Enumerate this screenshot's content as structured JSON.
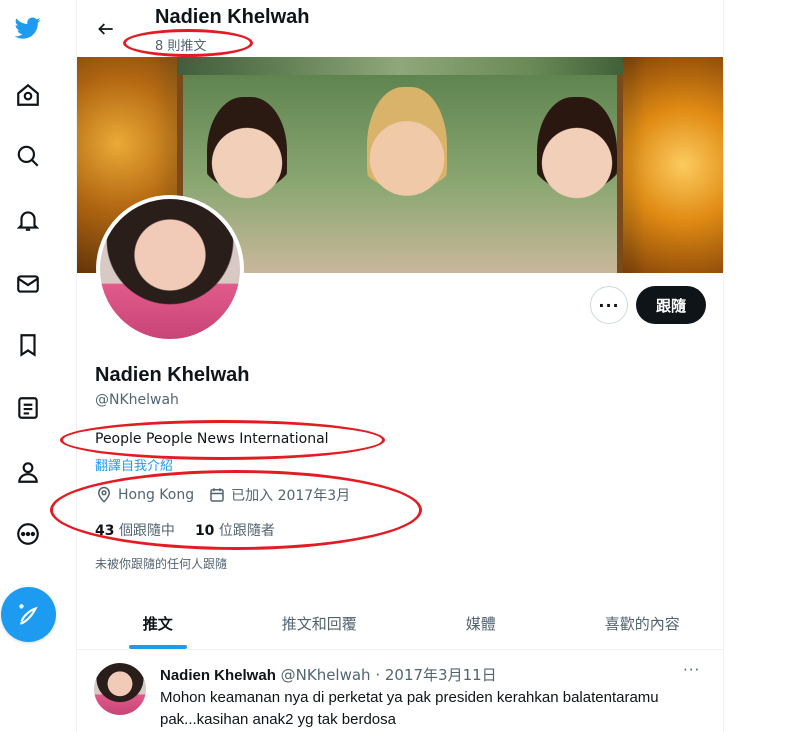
{
  "colors": {
    "accent": "#1d9bf0",
    "text": "#0f1419",
    "secondary": "#536471",
    "annotation": "#e31b23"
  },
  "rail": {
    "icons": [
      "twitter-logo",
      "home-icon",
      "search-icon",
      "notification-bell-icon",
      "messages-mail-icon",
      "bookmark-icon",
      "lists-icon",
      "profile-icon",
      "more-circle-icon",
      "compose-tweet-icon"
    ]
  },
  "header": {
    "title": "Nadien Khelwah",
    "tweet_count": "8 則推文"
  },
  "profile": {
    "name": "Nadien Khelwah",
    "handle": "@NKhelwah",
    "bio": "People People News International",
    "translate_link": "翻譯自我介紹",
    "location": "Hong Kong",
    "joined": "已加入 2017年3月",
    "following_count": "43",
    "following_label": "個跟隨中",
    "followers_count": "10",
    "followers_label": "位跟隨者",
    "followed_by_note": "未被你跟隨的任何人跟隨",
    "more_label": "···",
    "follow_label": "跟隨"
  },
  "tabs": [
    {
      "label": "推文",
      "active": true
    },
    {
      "label": "推文和回覆",
      "active": false
    },
    {
      "label": "媒體",
      "active": false
    },
    {
      "label": "喜歡的內容",
      "active": false
    }
  ],
  "tweet": {
    "name": "Nadien Khelwah",
    "meta": "@NKhelwah · 2017年3月11日",
    "more": "···",
    "text": "Mohon keamanan nya di perketat ya pak presiden kerahkan balatentaramu pak...kasihan anak2 yg tak berdosa"
  }
}
